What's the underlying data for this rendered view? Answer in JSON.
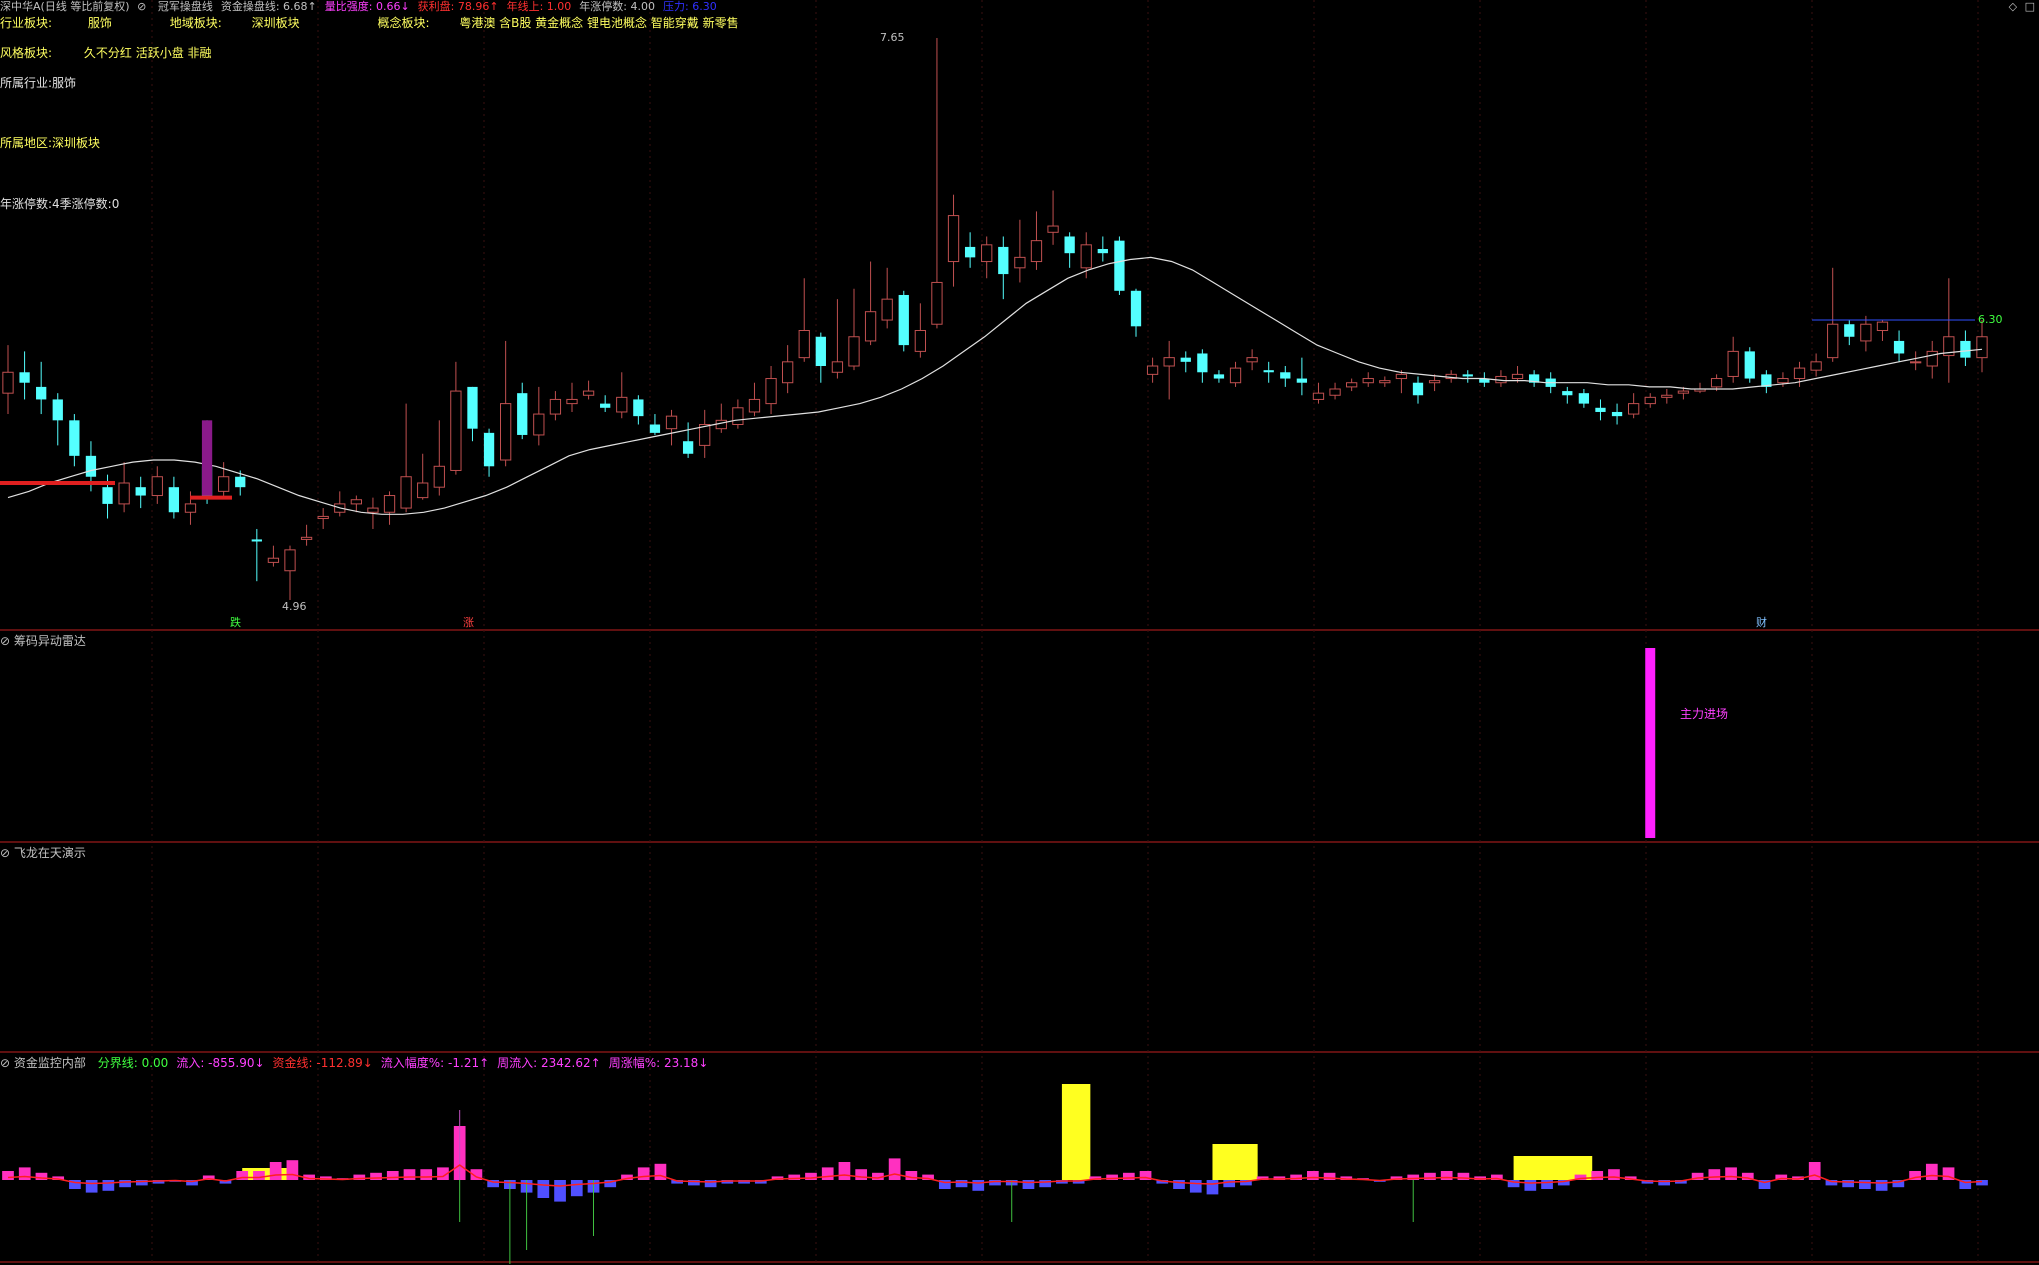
{
  "header": {
    "title": "深中华A(日线 等比前复权)",
    "items": [
      {
        "label": "冠军操盘线",
        "value": "",
        "color": "#c0c0c0"
      },
      {
        "label": "资金操盘线: ",
        "value": "6.68↑",
        "color": "#c0c0c0"
      },
      {
        "label": "量比强度: ",
        "value": "0.66↓",
        "color": "#ff40ff"
      },
      {
        "label": "获利盘: ",
        "value": "78.96↑",
        "color": "#ff3030"
      },
      {
        "label": "年线上: ",
        "value": "1.00",
        "color": "#ff3030"
      },
      {
        "label": "年涨停数: ",
        "value": "4.00",
        "color": "#c0c0c0"
      },
      {
        "label": "压力: ",
        "value": "6.30",
        "color": "#3030ff"
      }
    ]
  },
  "info": {
    "industry_label": "行业板块:",
    "industry_value": "服饰",
    "region_label": "地域板块:",
    "region_value": "深圳板块",
    "concept_label": "概念板块:",
    "concept_value": "粤港澳 含B股 黄金概念 锂电池概念 智能穿戴 新零售",
    "style_label": "风格板块:",
    "style_value": "久不分红 活跃小盘 非融",
    "line1": "所属行业:服饰",
    "line2": "所属地区:深圳板块",
    "line3": "年涨停数:4季涨停数:0"
  },
  "markers": {
    "low": "4.96",
    "high": "7.65",
    "pressure": "6.30",
    "mark1": "跌",
    "mark2": "涨",
    "mark3": "财"
  },
  "panel2": {
    "title": "筹码异动雷达",
    "annotation": "主力进场"
  },
  "panel3": {
    "title": "飞龙在天演示"
  },
  "panel4": {
    "title": "资金监控内部",
    "items": [
      {
        "label": "分界线: ",
        "value": "0.00",
        "color": "#40ff40"
      },
      {
        "label": "流入: ",
        "value": "-855.90↓",
        "color": "#ff40ff"
      },
      {
        "label": "资金线: ",
        "value": "-112.89↓",
        "color": "#ff3030"
      },
      {
        "label": "流入幅度%: ",
        "value": "-1.21↑",
        "color": "#ff40ff"
      },
      {
        "label": "周流入: ",
        "value": "2342.62↑",
        "color": "#ff40ff"
      },
      {
        "label": "周涨幅%: ",
        "value": "23.18↓",
        "color": "#ff40ff"
      }
    ]
  },
  "chart_data": {
    "type": "candlestick",
    "price_range": [
      4.96,
      7.65
    ],
    "candles": [
      [
        5.95,
        6.05,
        6.18,
        5.85
      ],
      [
        6.05,
        6.0,
        6.15,
        5.92
      ],
      [
        5.98,
        5.92,
        6.1,
        5.85
      ],
      [
        5.92,
        5.82,
        5.95,
        5.7
      ],
      [
        5.82,
        5.65,
        5.85,
        5.6
      ],
      [
        5.65,
        5.55,
        5.72,
        5.48
      ],
      [
        5.5,
        5.42,
        5.56,
        5.35
      ],
      [
        5.42,
        5.52,
        5.62,
        5.38
      ],
      [
        5.5,
        5.46,
        5.55,
        5.4
      ],
      [
        5.46,
        5.55,
        5.6,
        5.42
      ],
      [
        5.5,
        5.38,
        5.55,
        5.35
      ],
      [
        5.38,
        5.42,
        5.48,
        5.32
      ],
      [
        5.6,
        5.45,
        5.82,
        5.42
      ],
      [
        5.48,
        5.55,
        5.62,
        5.45
      ],
      [
        5.55,
        5.5,
        5.58,
        5.46
      ],
      [
        5.25,
        5.24,
        5.3,
        5.05
      ],
      [
        5.14,
        5.16,
        5.22,
        5.12
      ],
      [
        5.1,
        5.2,
        5.22,
        4.96
      ],
      [
        5.25,
        5.26,
        5.32,
        5.22
      ],
      [
        5.35,
        5.36,
        5.4,
        5.3
      ],
      [
        5.38,
        5.42,
        5.48,
        5.36
      ],
      [
        5.42,
        5.44,
        5.46,
        5.38
      ],
      [
        5.38,
        5.4,
        5.45,
        5.3
      ],
      [
        5.38,
        5.46,
        5.48,
        5.32
      ],
      [
        5.4,
        5.55,
        5.9,
        5.38
      ],
      [
        5.45,
        5.52,
        5.66,
        5.44
      ],
      [
        5.5,
        5.6,
        5.82,
        5.46
      ],
      [
        5.58,
        5.96,
        6.1,
        5.56
      ],
      [
        5.98,
        5.78,
        5.98,
        5.72
      ],
      [
        5.76,
        5.6,
        5.78,
        5.55
      ],
      [
        5.63,
        5.9,
        6.2,
        5.6
      ],
      [
        5.95,
        5.75,
        6.0,
        5.73
      ],
      [
        5.75,
        5.85,
        5.98,
        5.7
      ],
      [
        5.85,
        5.92,
        5.96,
        5.82
      ],
      [
        5.9,
        5.92,
        6.0,
        5.86
      ],
      [
        5.94,
        5.96,
        6.01,
        5.92
      ],
      [
        5.9,
        5.88,
        5.94,
        5.86
      ],
      [
        5.86,
        5.93,
        6.05,
        5.83
      ],
      [
        5.92,
        5.84,
        5.94,
        5.8
      ],
      [
        5.8,
        5.76,
        5.85,
        5.75
      ],
      [
        5.78,
        5.84,
        5.87,
        5.7
      ],
      [
        5.72,
        5.66,
        5.81,
        5.64
      ],
      [
        5.7,
        5.8,
        5.87,
        5.64
      ],
      [
        5.78,
        5.82,
        5.9,
        5.76
      ],
      [
        5.8,
        5.88,
        5.92,
        5.78
      ],
      [
        5.86,
        5.92,
        6.0,
        5.84
      ],
      [
        5.9,
        6.02,
        6.08,
        5.85
      ],
      [
        6.0,
        6.1,
        6.18,
        5.95
      ],
      [
        6.12,
        6.25,
        6.5,
        6.1
      ],
      [
        6.22,
        6.08,
        6.24,
        6.0
      ],
      [
        6.05,
        6.1,
        6.4,
        6.02
      ],
      [
        6.08,
        6.22,
        6.45,
        6.06
      ],
      [
        6.2,
        6.34,
        6.58,
        6.18
      ],
      [
        6.3,
        6.4,
        6.55,
        6.26
      ],
      [
        6.42,
        6.18,
        6.44,
        6.15
      ],
      [
        6.15,
        6.25,
        6.38,
        6.12
      ],
      [
        6.28,
        6.48,
        7.65,
        6.26
      ],
      [
        6.58,
        6.8,
        6.9,
        6.46
      ],
      [
        6.65,
        6.6,
        6.72,
        6.55
      ],
      [
        6.58,
        6.66,
        6.7,
        6.5
      ],
      [
        6.65,
        6.52,
        6.7,
        6.4
      ],
      [
        6.55,
        6.6,
        6.78,
        6.48
      ],
      [
        6.58,
        6.68,
        6.82,
        6.54
      ],
      [
        6.72,
        6.75,
        6.92,
        6.66
      ],
      [
        6.7,
        6.62,
        6.72,
        6.55
      ],
      [
        6.55,
        6.66,
        6.72,
        6.5
      ],
      [
        6.64,
        6.62,
        6.7,
        6.58
      ],
      [
        6.68,
        6.44,
        6.7,
        6.42
      ],
      [
        6.44,
        6.27,
        6.45,
        6.22
      ],
      [
        6.04,
        6.08,
        6.12,
        6.0
      ],
      [
        6.08,
        6.12,
        6.2,
        5.92
      ],
      [
        6.12,
        6.1,
        6.15,
        6.05
      ],
      [
        6.14,
        6.05,
        6.16,
        6.0
      ],
      [
        6.04,
        6.02,
        6.06,
        6.0
      ],
      [
        6.0,
        6.07,
        6.1,
        5.98
      ],
      [
        6.1,
        6.12,
        6.16,
        6.06
      ],
      [
        6.06,
        6.05,
        6.1,
        6.0
      ],
      [
        6.05,
        6.02,
        6.08,
        5.98
      ],
      [
        6.02,
        6.0,
        6.12,
        5.94
      ],
      [
        5.92,
        5.95,
        6.0,
        5.9
      ],
      [
        5.94,
        5.97,
        6.0,
        5.92
      ],
      [
        5.98,
        6.0,
        6.02,
        5.96
      ],
      [
        6.0,
        6.02,
        6.05,
        5.98
      ],
      [
        6.0,
        6.01,
        6.03,
        5.98
      ],
      [
        6.02,
        6.04,
        6.06,
        5.95
      ],
      [
        6.0,
        5.94,
        6.03,
        5.9
      ],
      [
        6.0,
        6.01,
        6.04,
        5.96
      ],
      [
        6.02,
        6.04,
        6.06,
        6.0
      ],
      [
        6.04,
        6.03,
        6.06,
        6.0
      ],
      [
        6.02,
        6.0,
        6.05,
        5.98
      ],
      [
        6.0,
        6.03,
        6.06,
        5.98
      ],
      [
        6.02,
        6.04,
        6.08,
        6.0
      ],
      [
        6.04,
        6.0,
        6.06,
        5.98
      ],
      [
        6.02,
        5.98,
        6.05,
        5.95
      ],
      [
        5.96,
        5.94,
        5.98,
        5.9
      ],
      [
        5.95,
        5.9,
        5.97,
        5.88
      ],
      [
        5.88,
        5.86,
        5.92,
        5.82
      ],
      [
        5.86,
        5.84,
        5.9,
        5.8
      ],
      [
        5.85,
        5.9,
        5.95,
        5.83
      ],
      [
        5.9,
        5.93,
        5.95,
        5.88
      ],
      [
        5.93,
        5.94,
        5.97,
        5.9
      ],
      [
        5.95,
        5.96,
        5.98,
        5.92
      ],
      [
        5.96,
        5.97,
        6.0,
        5.95
      ],
      [
        5.98,
        6.02,
        6.04,
        5.96
      ],
      [
        6.03,
        6.15,
        6.22,
        6.0
      ],
      [
        6.15,
        6.02,
        6.17,
        6.0
      ],
      [
        6.04,
        5.98,
        6.06,
        5.95
      ],
      [
        6.0,
        6.02,
        6.05,
        5.98
      ],
      [
        6.02,
        6.07,
        6.1,
        5.98
      ],
      [
        6.06,
        6.1,
        6.14,
        6.03
      ],
      [
        6.12,
        6.28,
        6.55,
        6.1
      ],
      [
        6.28,
        6.22,
        6.3,
        6.18
      ],
      [
        6.2,
        6.28,
        6.32,
        6.15
      ],
      [
        6.25,
        6.29,
        6.3,
        6.2
      ],
      [
        6.2,
        6.14,
        6.25,
        6.1
      ],
      [
        6.1,
        6.1,
        6.15,
        6.06
      ],
      [
        6.08,
        6.15,
        6.2,
        6.02
      ],
      [
        6.13,
        6.22,
        6.5,
        6.0
      ],
      [
        6.2,
        6.12,
        6.25,
        6.08
      ],
      [
        6.12,
        6.22,
        6.3,
        6.05
      ]
    ],
    "ma": [
      5.45,
      5.48,
      5.52,
      5.55,
      5.58,
      5.6,
      5.62,
      5.63,
      5.63,
      5.62,
      5.6,
      5.57,
      5.54,
      5.5,
      5.46,
      5.43,
      5.4,
      5.38,
      5.37,
      5.37,
      5.38,
      5.4,
      5.43,
      5.46,
      5.5,
      5.55,
      5.6,
      5.65,
      5.68,
      5.7,
      5.72,
      5.74,
      5.76,
      5.78,
      5.8,
      5.82,
      5.83,
      5.84,
      5.85,
      5.86,
      5.88,
      5.9,
      5.93,
      5.97,
      6.02,
      6.08,
      6.15,
      6.22,
      6.3,
      6.38,
      6.44,
      6.5,
      6.54,
      6.57,
      6.59,
      6.6,
      6.58,
      6.54,
      6.48,
      6.42,
      6.36,
      6.3,
      6.24,
      6.18,
      6.14,
      6.1,
      6.07,
      6.05,
      6.04,
      6.03,
      6.02,
      6.02,
      6.01,
      6.01,
      6.0,
      6.0,
      6.0,
      5.99,
      5.99,
      5.98,
      5.98,
      5.97,
      5.97,
      5.97,
      5.98,
      5.99,
      6.0,
      6.02,
      6.04,
      6.06,
      6.08,
      6.1,
      6.12,
      6.14,
      6.15,
      6.16
    ],
    "ma_start_index": 0,
    "inflow": [
      10,
      14,
      8,
      4,
      -10,
      -14,
      -12,
      -8,
      -6,
      -4,
      -2,
      -6,
      5,
      -4,
      10,
      10,
      20,
      22,
      6,
      4,
      2,
      6,
      8,
      10,
      12,
      12,
      14,
      60,
      12,
      -8,
      -10,
      -14,
      -20,
      -24,
      -18,
      -14,
      -8,
      6,
      14,
      18,
      -4,
      -6,
      -8,
      -4,
      -4,
      -4,
      4,
      6,
      8,
      14,
      20,
      12,
      8,
      24,
      10,
      6,
      -10,
      -8,
      -12,
      -6,
      -6,
      -10,
      -8,
      -4,
      -4,
      4,
      6,
      8,
      10,
      -4,
      -10,
      -14,
      -16,
      -8,
      -6,
      4,
      4,
      6,
      10,
      8,
      4,
      2,
      -2,
      4,
      6,
      8,
      10,
      8,
      4,
      6,
      -8,
      -12,
      -10,
      -6,
      6,
      10,
      12,
      4,
      -4,
      -6,
      -4,
      8,
      12,
      14,
      8,
      -10,
      6,
      4,
      20,
      -6,
      -8,
      -10,
      -12,
      -8,
      10,
      18,
      14,
      -10,
      -6
    ],
    "yellow_blocks": [
      {
        "from": 14,
        "to": 16,
        "level": 10
      },
      {
        "from": 63,
        "to": 64,
        "level": 80
      },
      {
        "from": 72,
        "to": 74,
        "level": 30
      },
      {
        "from": 90,
        "to": 94,
        "level": 20
      }
    ],
    "radar_bar": {
      "index": 99,
      "level": 100
    }
  }
}
